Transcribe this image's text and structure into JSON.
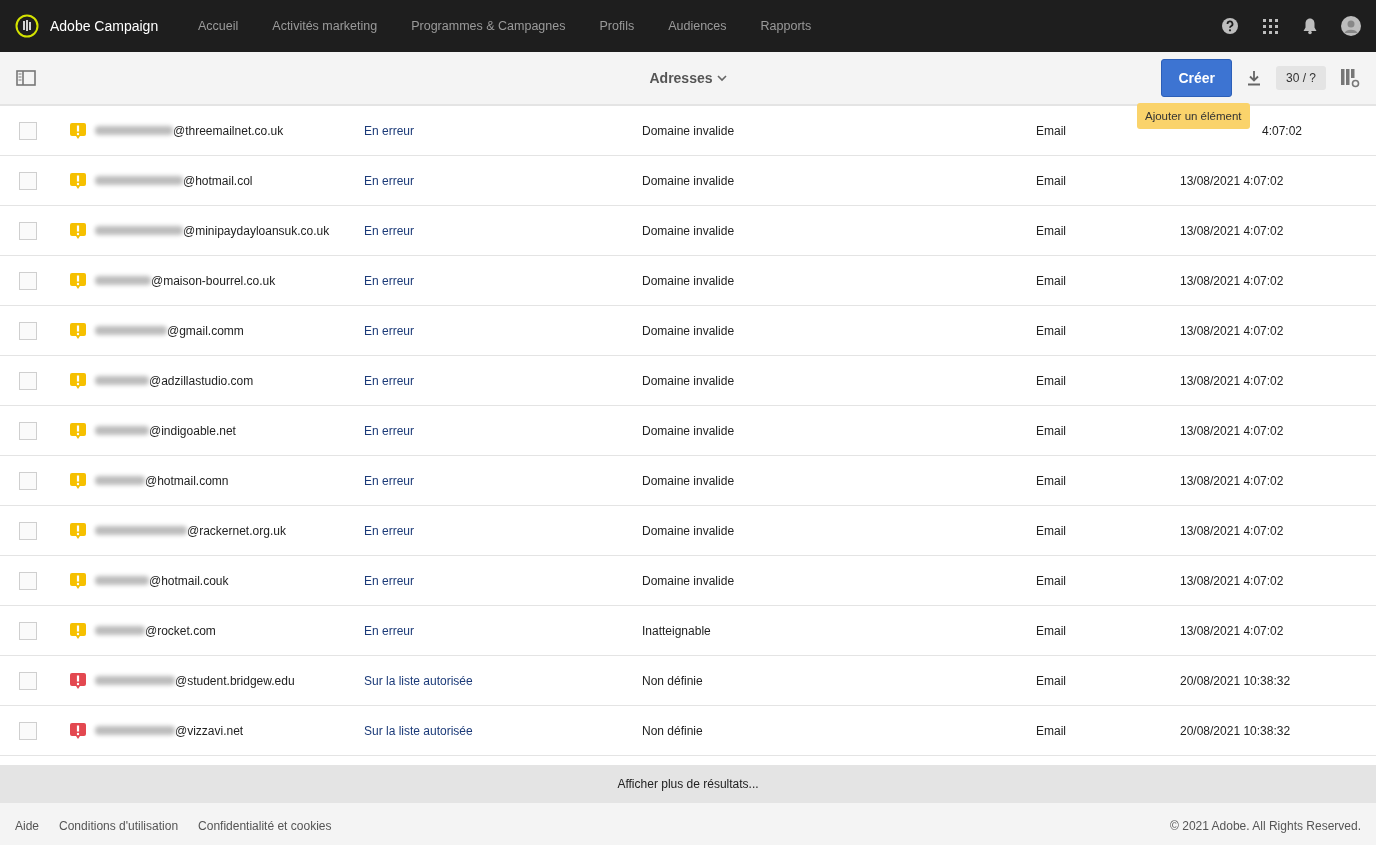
{
  "header": {
    "brand": "Adobe Campaign",
    "nav": [
      {
        "label": "Accueil",
        "selected": false
      },
      {
        "label": "Activités marketing",
        "selected": false
      },
      {
        "label": "Programmes & Campagnes",
        "selected": false
      },
      {
        "label": "Profils",
        "selected": false
      },
      {
        "label": "Audiences",
        "selected": false
      },
      {
        "label": "Rapports",
        "selected": false
      }
    ]
  },
  "toolbar": {
    "title": "Adresses",
    "create": "Créer",
    "tooltip": "Ajouter un élément",
    "count": "30 / ?"
  },
  "rows": [
    {
      "checked": false,
      "color": "#f6c000",
      "email": "@threemailnet.co.uk",
      "status": "En erreur",
      "reason": "Domaine invalide",
      "channel": "Email",
      "date": "4:07:02"
    },
    {
      "checked": false,
      "color": "#f6c000",
      "email": "@hotmail.col",
      "status": "En erreur",
      "reason": "Domaine invalide",
      "channel": "Email",
      "date": "13/08/2021 4:07:02"
    },
    {
      "checked": false,
      "color": "#f6c000",
      "email": "@minipaydayloansuk.co.uk",
      "status": "En erreur",
      "reason": "Domaine invalide",
      "channel": "Email",
      "date": "13/08/2021 4:07:02"
    },
    {
      "checked": false,
      "color": "#f6c000",
      "email": "@maison-bourrel.co.uk",
      "status": "En erreur",
      "reason": "Domaine invalide",
      "channel": "Email",
      "date": "13/08/2021 4:07:02"
    },
    {
      "checked": false,
      "color": "#f6c000",
      "email": "@gmail.comm",
      "status": "En erreur",
      "reason": "Domaine invalide",
      "channel": "Email",
      "date": "13/08/2021 4:07:02"
    },
    {
      "checked": false,
      "color": "#f6c000",
      "email": "@adzillastudio.com",
      "status": "En erreur",
      "reason": "Domaine invalide",
      "channel": "Email",
      "date": "13/08/2021 4:07:02"
    },
    {
      "checked": false,
      "color": "#f6c000",
      "email": "@indigoable.net",
      "status": "En erreur",
      "reason": "Domaine invalide",
      "channel": "Email",
      "date": "13/08/2021 4:07:02"
    },
    {
      "checked": false,
      "color": "#f6c000",
      "email": "@hotmail.comn",
      "status": "En erreur",
      "reason": "Domaine invalide",
      "channel": "Email",
      "date": "13/08/2021 4:07:02"
    },
    {
      "checked": false,
      "color": "#f6c000",
      "email": "@rackernet.org.uk",
      "status": "En erreur",
      "reason": "Domaine invalide",
      "channel": "Email",
      "date": "13/08/2021 4:07:02"
    },
    {
      "checked": false,
      "color": "#f6c000",
      "email": "@hotmail.couk",
      "status": "En erreur",
      "reason": "Domaine invalide",
      "channel": "Email",
      "date": "13/08/2021 4:07:02"
    },
    {
      "checked": false,
      "color": "#f6c000",
      "email": "@rocket.com",
      "status": "En erreur",
      "reason": "Inatteignable",
      "channel": "Email",
      "date": "13/08/2021 4:07:02"
    },
    {
      "checked": false,
      "color": "#e34850",
      "email": "@student.bridgew.edu",
      "status": "Sur la liste autorisée",
      "reason": "Non définie",
      "channel": "Email",
      "date": "20/08/2021 10:38:32"
    },
    {
      "checked": false,
      "color": "#e34850",
      "email": "@vizzavi.net",
      "status": "Sur la liste autorisée",
      "reason": "Non définie",
      "channel": "Email",
      "date": "20/08/2021 10:38:32"
    }
  ],
  "more": "Afficher plus de résultats...",
  "footer": {
    "links": [
      "Aide",
      "Conditions d'utilisation",
      "Confidentialité et cookies"
    ],
    "copyright": "© 2021 Adobe. All Rights Reserved."
  }
}
